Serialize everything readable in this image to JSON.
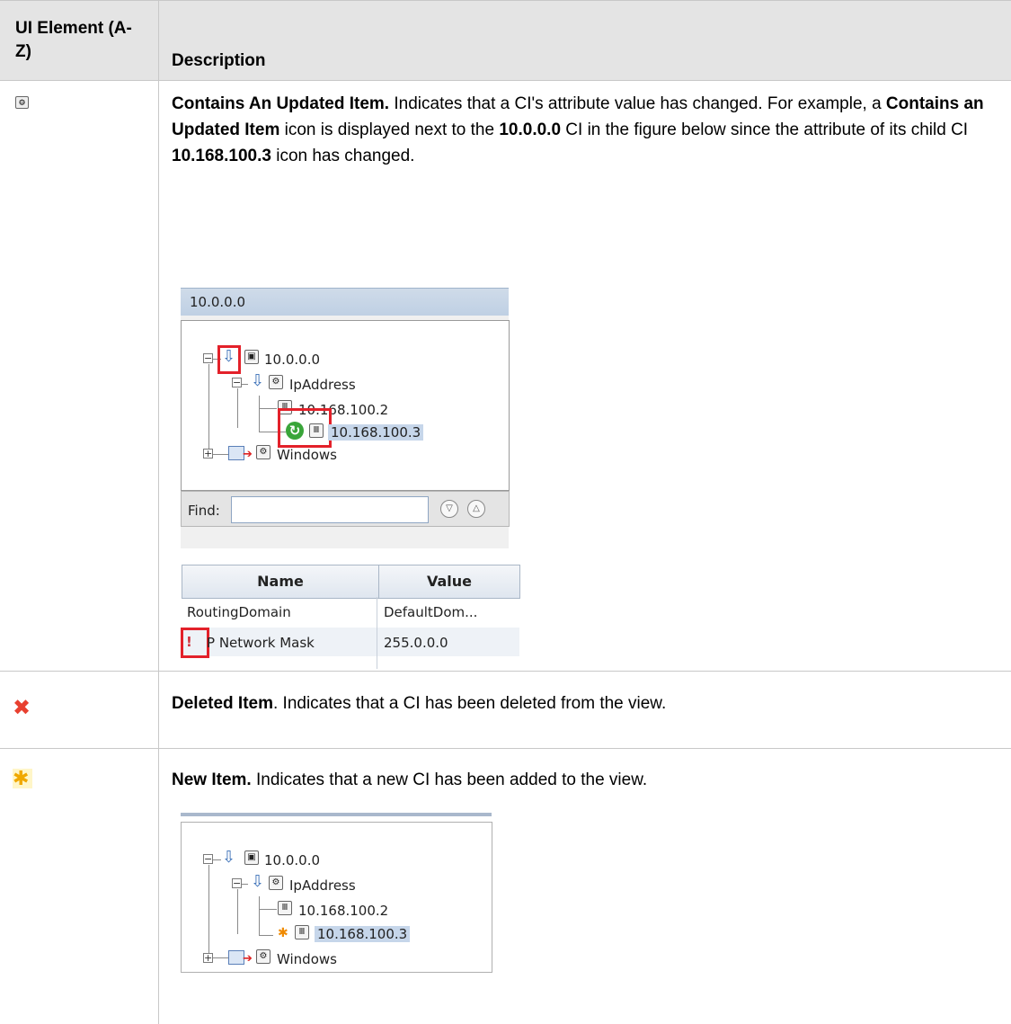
{
  "header": {
    "col1_label": "UI Element (A-Z)",
    "col2_label": "Description"
  },
  "rows": [
    {
      "icon": "contains-updated-item-icon",
      "title": "Contains An Updated Item.",
      "text1": " Indicates that a CI's attribute value has changed. For example, a ",
      "bold_inline": "Contains an Updated Item",
      "text2": " icon is displayed next to the ",
      "ci_name": "10.0.0.0",
      "text3": " CI in the figure below since the attribute of its child CI ",
      "child_ci": "10.168.100.3",
      "text4": " icon has changed."
    },
    {
      "icon": "deleted-item-icon",
      "title": "Deleted Item",
      "text": ". Indicates that a CI has been deleted from the view."
    },
    {
      "icon": "new-item-icon",
      "title": "New Item.",
      "text": " Indicates that a new CI has been added to the view."
    }
  ],
  "figure1": {
    "title": "10.0.0.0",
    "tree": {
      "root": "10.0.0.0",
      "ip_group": "IpAddress",
      "ip1": "10.168.100.2",
      "ip2": "10.168.100.3",
      "windows": "Windows"
    },
    "find_label": "Find:",
    "props": {
      "col_name": "Name",
      "col_value": "Value",
      "rows": [
        {
          "name": "RoutingDomain",
          "value": "DefaultDom..."
        },
        {
          "name": "P Network Mask",
          "value": "255.0.0.0"
        }
      ]
    }
  },
  "figure2": {
    "tree": {
      "root": "10.0.0.0",
      "ip_group": "IpAddress",
      "ip1": "10.168.100.2",
      "ip2": "10.168.100.3",
      "windows": "Windows"
    }
  },
  "colors": {
    "header_bg": "#e4e4e4",
    "highlight_red": "#e3212a",
    "tree_arrow_blue": "#3a6fb7",
    "selection_blue": "#c6d6ea"
  }
}
